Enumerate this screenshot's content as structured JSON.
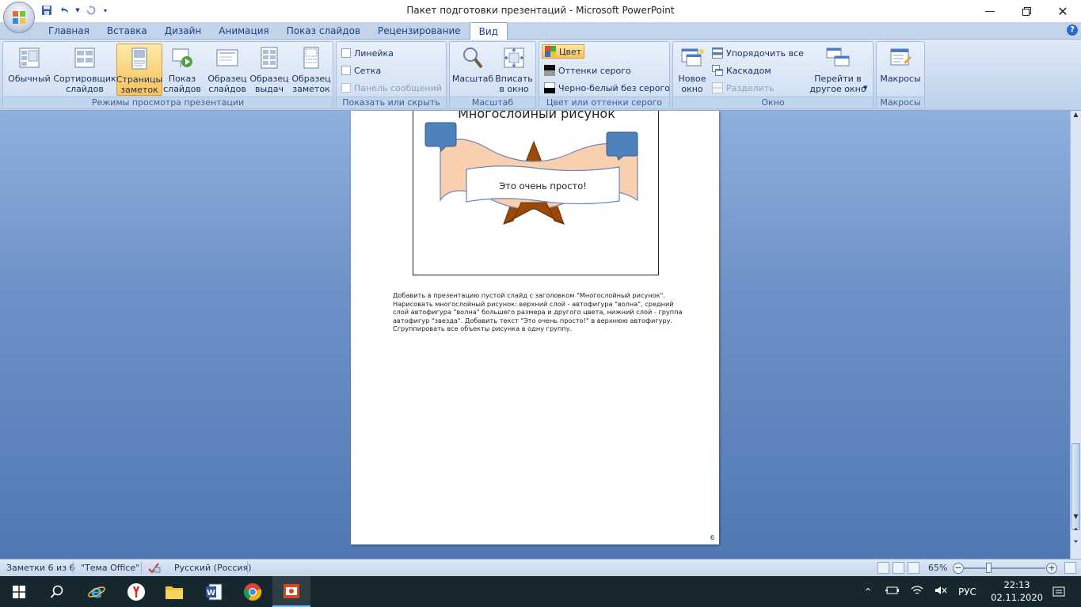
{
  "window": {
    "title": "Пакет подготовки презентаций - Microsoft PowerPoint"
  },
  "tabs": [
    "Главная",
    "Вставка",
    "Дизайн",
    "Анимация",
    "Показ слайдов",
    "Рецензирование",
    "Вид"
  ],
  "active_tab": "Вид",
  "ribbon": {
    "views": {
      "label": "Режимы просмотра презентации",
      "normal": "Обычный",
      "sorter": "Сортировщик\nслайдов",
      "notes_page": "Страницы\nзаметок",
      "slideshow": "Показ\nслайдов",
      "slide_master": "Образец\nслайдов",
      "handout_master": "Образец\nвыдач",
      "notes_master": "Образец\nзаметок"
    },
    "show_hide": {
      "label": "Показать или скрыть",
      "ruler": "Линейка",
      "grid": "Сетка",
      "message_bar": "Панель сообщений"
    },
    "zoom": {
      "label": "Масштаб",
      "zoom": "Масштаб",
      "fit": "Вписать\nв окно"
    },
    "color": {
      "label": "Цвет или оттенки серого",
      "color": "Цвет",
      "grayscale": "Оттенки серого",
      "bw": "Черно-белый без серого"
    },
    "window": {
      "label": "Окно",
      "new_window": "Новое\nокно",
      "arrange_all": "Упорядочить все",
      "cascade": "Каскадом",
      "split": "Разделить",
      "switch": "Перейти в\nдругое окно"
    },
    "macros": {
      "label": "Макросы",
      "macros": "Макросы"
    }
  },
  "slide": {
    "title": "Многослойный рисунок",
    "banner_text": "Это очень просто!"
  },
  "notes": {
    "text": "Добавить в презентацию  пустой слайд с заголовком  \"Многослойный  рисунок\". Нарисовать многослойный  рисунок: верхний слой - автофигура \"волна\", средний слой автофигура \"волна\" большего  размера и другого цвета, нижний слой - группа автофигур \"звезда\". Добавить текст \"Это очень просто!\"  в верхнюю автофигуру. Сгруппировать  все объекты рисунка в одну группу.",
    "page_number": "6"
  },
  "statusbar": {
    "page": "Заметки 6 из 6",
    "theme": "\"Тема Office\"",
    "language": "Русский (Россия)",
    "zoom": "65%",
    "zoom_level": 0.65
  },
  "taskbar": {
    "lang": "РУС",
    "time": "22:13",
    "date": "02.11.2020"
  },
  "colors": {
    "star": "#9a4a08",
    "wave": "#f9cfae",
    "callout": "#4f81bd",
    "active_button": "#f9c25a"
  }
}
